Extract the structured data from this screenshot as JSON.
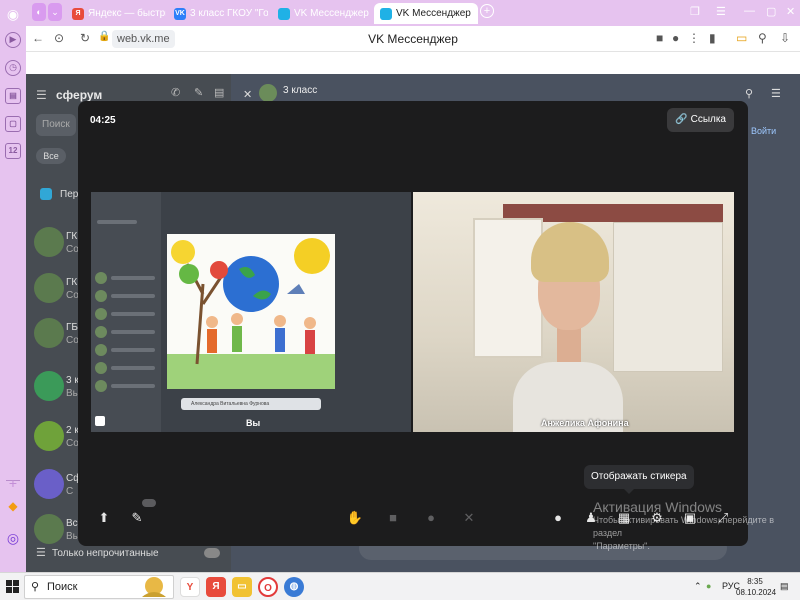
{
  "browser": {
    "tabs": [
      {
        "label": "Яндекс — быстрый поиск",
        "favicon": "Я",
        "color": "#e84b3c"
      },
      {
        "label": "3 класс ГКОУ \"Горловская",
        "favicon": "VK",
        "color": "#2d7ff9"
      },
      {
        "label": "VK Мессенджер",
        "favicon": "",
        "color": "#1fb1e6"
      },
      {
        "label": "VK Мессенджер",
        "favicon": "",
        "color": "#1fb1e6",
        "active": true
      }
    ],
    "url": "web.vk.me",
    "page_title": "VK Мессенджер",
    "rail_badge": "12"
  },
  "vk": {
    "brand": "сферум",
    "search_stub": "Поиск",
    "filter_pill": "Все",
    "chat_header": "3 класс",
    "chat_stubs": [
      "ГК",
      "ГК",
      "ГБ",
      "3 к",
      "2 к",
      "Сф",
      "Вс"
    ],
    "chat_subs": [
      "Со",
      "Со",
      "Со",
      "Вы",
      "Со",
      "С",
      "Вы"
    ],
    "pinned": "Пере",
    "only_unread": "Только непрочитанные",
    "enter_btn": "Войти"
  },
  "call": {
    "timer": "04:25",
    "link_button": "Ссылка",
    "self_label": "Вы",
    "participant_name": "Анжелика Афонина",
    "share_bar_text": "Александра Витальевна Фурнова",
    "tooltip": "Отображать стикера",
    "controls": [
      "share-screen-icon",
      "effects-icon",
      "raise-hand-icon",
      "camera-icon",
      "microphone-icon",
      "end-call-icon",
      "chat-icon",
      "participants-icon",
      "layout-icon",
      "settings-icon",
      "pip-icon",
      "fullscreen-icon"
    ]
  },
  "watermark": {
    "title": "Активация Windows",
    "line1": "Чтобы активировать Windows, перейдите в раздел",
    "line2": "\"Параметры\"."
  },
  "taskbar": {
    "search": "Поиск",
    "lang": "РУС",
    "time": "8:35",
    "date": "08.10.2024"
  }
}
